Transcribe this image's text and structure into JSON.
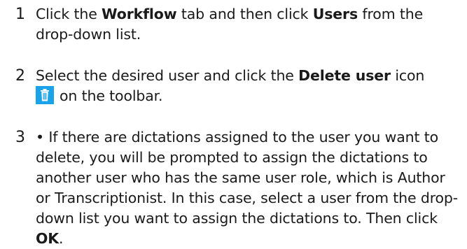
{
  "steps": [
    {
      "number": "1",
      "parts": [
        {
          "text": "Click the "
        },
        {
          "text": "Workflow",
          "bold": true
        },
        {
          "text": " tab and then click "
        },
        {
          "text": "Users",
          "bold": true
        },
        {
          "text": " from the drop-down list."
        }
      ]
    },
    {
      "number": "2",
      "parts_before": [
        {
          "text": "Select the desired user and click the "
        },
        {
          "text": "Delete user",
          "bold": true
        },
        {
          "text": " icon"
        }
      ],
      "icon": "trash-icon",
      "parts_after": [
        {
          "text": "on the toolbar."
        }
      ]
    },
    {
      "number": "3",
      "bullet": "•",
      "parts": [
        {
          "text": " If there are dictations assigned to the user you want to delete, you will be prompted to assign the dictations to another user who has the same user role, which is Author or Transcriptionist. In this case, select a user from the drop-down list you want to assign the dictations to. Then click "
        },
        {
          "text": "OK",
          "bold": true
        },
        {
          "text": "."
        }
      ]
    }
  ],
  "colors": {
    "icon_background": "#1aa3e8",
    "text": "#1a1a1a"
  }
}
